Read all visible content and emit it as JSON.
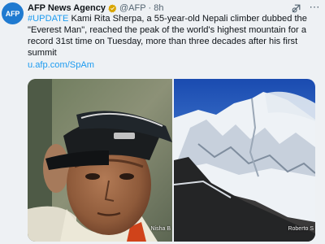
{
  "account": {
    "avatar_text": "AFP",
    "name": "AFP News Agency",
    "handle": "@AFP",
    "separator": "·",
    "time": "8h"
  },
  "tweet": {
    "hashtag": "#UPDATE",
    "line1_rest": " Kami Rita Sherpa, a 55-year-old Nepali climber dubbed the",
    "line2": "\"Everest Man\", reached the peak of the world's highest mountain for a",
    "line3": "record 31st time on Tuesday, more than three decades after his first summit",
    "link": "u.afp.com/SpAm"
  },
  "media": {
    "left_credit": "Nisha B",
    "right_credit": "Roberto S"
  },
  "icons": {
    "verified": "verified-badge-icon",
    "grok": "grok-icon",
    "more": "more-options-icon"
  },
  "colors": {
    "accent": "#1d9bf0",
    "background": "#eef1f4",
    "avatar": "#1f7ad0"
  }
}
